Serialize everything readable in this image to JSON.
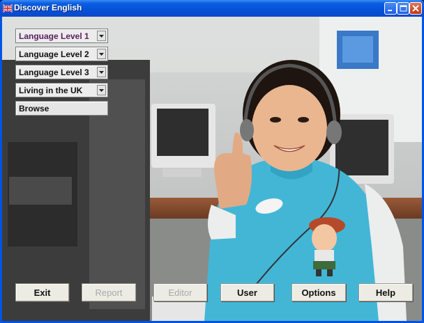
{
  "window": {
    "title": "Discover English"
  },
  "menu": {
    "selects": [
      {
        "label": "Language Level 1"
      },
      {
        "label": "Language Level 2"
      },
      {
        "label": "Language Level 3"
      },
      {
        "label": "Living in the UK"
      }
    ],
    "browse_label": "Browse"
  },
  "bottom_bar": {
    "exit": "Exit",
    "report": "Report",
    "editor": "Editor",
    "user": "User",
    "options": "Options",
    "help": "Help"
  },
  "colors": {
    "titlebar": "#0651d8",
    "sweater": "#43b6d6",
    "button_face": "#ecece4",
    "disabled_text": "#a8a8a8"
  },
  "icons": [
    "uk-flag-icon",
    "minimize-icon",
    "maximize-icon",
    "close-icon",
    "dropdown-arrow-icon",
    "mascot-boy-icon"
  ]
}
